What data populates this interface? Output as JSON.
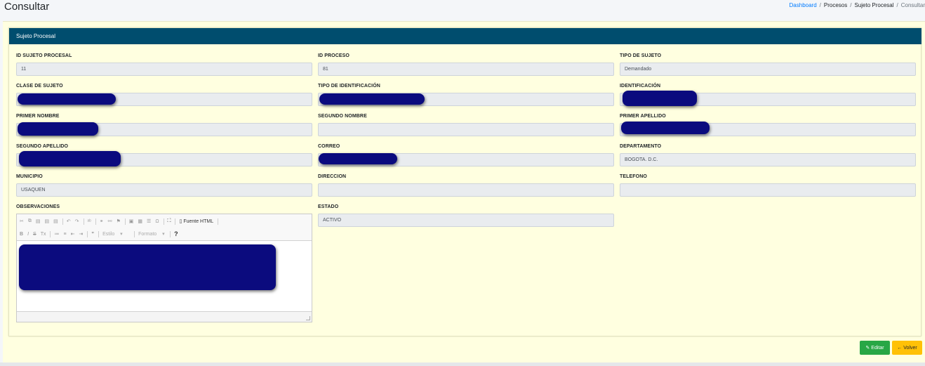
{
  "header": {
    "title": "Consultar",
    "breadcrumb": [
      "Dashboard",
      "Procesos",
      "Sujeto Procesal",
      "Consultar"
    ]
  },
  "card": {
    "title": "Sujeto Procesal",
    "fields": {
      "id_sujeto": {
        "label": "ID SUJETO PROCESAL",
        "value": "11"
      },
      "id_proceso": {
        "label": "ID PROCESO",
        "value": "81"
      },
      "tipo_sujeto": {
        "label": "TIPO DE SUJETO",
        "value": "Demandado"
      },
      "clase_sujeto": {
        "label": "CLASE DE SUJETO",
        "value": ""
      },
      "tipo_identificacion": {
        "label": "TIPO DE IDENTIFICACIÓN",
        "value": ""
      },
      "identificacion": {
        "label": "IDENTIFICACIÓN",
        "value": ""
      },
      "primer_nombre": {
        "label": "PRIMER NOMBRE",
        "value": ""
      },
      "segundo_nombre": {
        "label": "SEGUNDO NOMBRE",
        "value": ""
      },
      "primer_apellido": {
        "label": "PRIMER APELLIDO",
        "value": ""
      },
      "segundo_apellido": {
        "label": "SEGUNDO APELLIDO",
        "value": ""
      },
      "correo": {
        "label": "CORREO",
        "value": ""
      },
      "departamento": {
        "label": "DEPARTAMENTO",
        "value": "BOGOTA. D.C."
      },
      "municipio": {
        "label": "MUNICIPIO",
        "value": "USAQUEN"
      },
      "direccion": {
        "label": "DIRECCION",
        "value": ""
      },
      "telefono": {
        "label": "TELEFONO",
        "value": ""
      },
      "observaciones": {
        "label": "OBSERVACIONES"
      },
      "estado": {
        "label": "ESTADO",
        "value": "ACTIVO"
      }
    },
    "editor": {
      "source_label": "Fuente HTML",
      "style_combo": "Estilo",
      "format_combo": "Formato",
      "help": "?"
    }
  },
  "actions": {
    "edit_label": "Editar",
    "back_label": "Volver"
  },
  "colors": {
    "header_bg": "#004d6e",
    "panel_bg": "#ffffe0",
    "edit_btn": "#28a745",
    "back_btn": "#ffc107",
    "redaction": "#0b0b7e",
    "breadcrumb_link": "#007bff"
  }
}
